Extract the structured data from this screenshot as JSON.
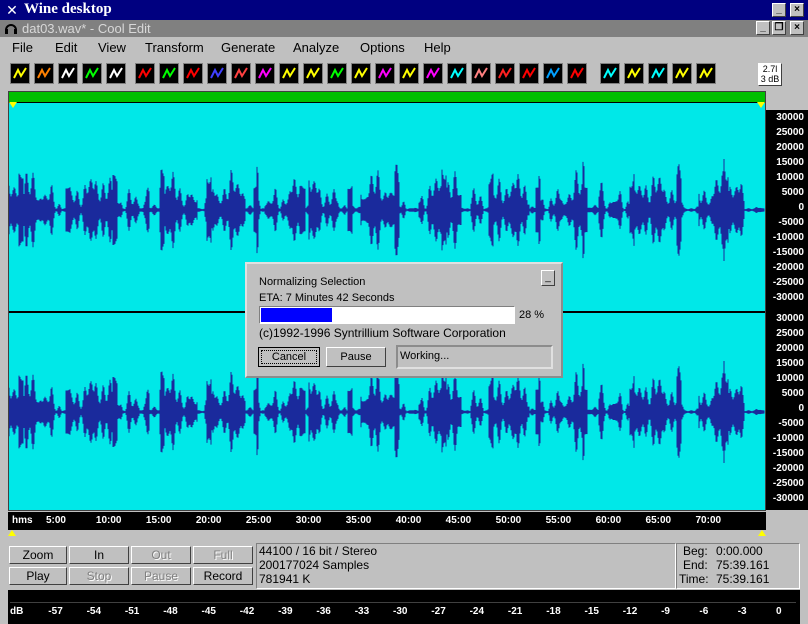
{
  "desktop": {
    "title": "Wine desktop"
  },
  "app": {
    "title": "dat03.wav* - Cool Edit"
  },
  "menu": [
    "File",
    "Edit",
    "View",
    "Transform",
    "Generate",
    "Analyze",
    "Options",
    "Help"
  ],
  "toolbar": {
    "level_readout_top": "2.7l",
    "level_readout_bottom": "3 dB"
  },
  "waveform": {
    "y_ticks_left_channel": [
      "30000",
      "25000",
      "20000",
      "15000",
      "10000",
      "5000",
      "0",
      "-5000",
      "-10000",
      "-15000",
      "-20000",
      "-25000",
      "-30000"
    ],
    "y_ticks_right_channel": [
      "30000",
      "25000",
      "20000",
      "15000",
      "10000",
      "5000",
      "0",
      "-5000",
      "-10000",
      "-15000",
      "-20000",
      "-25000",
      "-30000"
    ],
    "time_unit": "hms",
    "time_ticks": [
      "5:00",
      "10:00",
      "15:00",
      "20:00",
      "25:00",
      "30:00",
      "35:00",
      "40:00",
      "45:00",
      "50:00",
      "55:00",
      "60:00",
      "65:00",
      "70:00"
    ]
  },
  "dialog": {
    "title": "Normalizing Selection",
    "eta": "ETA: 7 Minutes 42 Seconds",
    "progress": 0.28,
    "progress_label": "28 %",
    "copyright": "(c)1992-1996 Syntrillium Software Corporation",
    "cancel_label": "Cancel",
    "pause_label": "Pause",
    "status": "Working..."
  },
  "controls": {
    "zoom": "Zoom",
    "in": "In",
    "out": "Out",
    "full": "Full",
    "play": "Play",
    "stop": "Stop",
    "pause": "Pause",
    "record": "Record"
  },
  "fileinfo": {
    "format": "44100 / 16 bit / Stereo",
    "samples": "200177024 Samples",
    "size": "781941 K"
  },
  "position": {
    "begin_label": "Beg:",
    "begin": "0:00.000",
    "end_label": "End:",
    "end": "75:39.161",
    "time_label": "Time:",
    "time": "75:39.161"
  },
  "meter": {
    "labels": [
      "dB",
      "-57",
      "-54",
      "-51",
      "-48",
      "-45",
      "-42",
      "-39",
      "-36",
      "-33",
      "-30",
      "-27",
      "-24",
      "-21",
      "-18",
      "-15",
      "-12",
      "-9",
      "-6",
      "-3",
      "0"
    ]
  }
}
